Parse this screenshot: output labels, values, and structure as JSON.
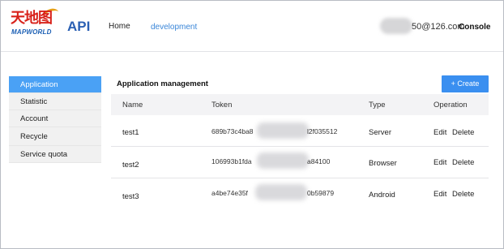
{
  "header": {
    "logo_cn": "天地图",
    "logo_en": "MAPWORLD",
    "title": "API",
    "nav": [
      "Home",
      "development"
    ],
    "email": "50@126.com",
    "console": "Console"
  },
  "sidebar": {
    "items": [
      {
        "label": "Application",
        "active": true
      },
      {
        "label": "Statistic",
        "active": false
      },
      {
        "label": "Account",
        "active": false
      },
      {
        "label": "Recycle",
        "active": false
      },
      {
        "label": "Service quota",
        "active": false
      }
    ]
  },
  "main": {
    "title": "Application management",
    "create_label": "+ Create",
    "columns": [
      "Name",
      "Token",
      "Type",
      "Operation"
    ],
    "rows": [
      {
        "name": "test1",
        "token_start": "689b73c4ba8",
        "token_end": "l2f035512",
        "type": "Server",
        "edit": "Edit",
        "delete": "Delete"
      },
      {
        "name": "test2",
        "token_start": "106993b1fda",
        "token_end": "a84100",
        "type": "Browser",
        "edit": "Edit",
        "delete": "Delete"
      },
      {
        "name": "test3",
        "token_start": "a4be74e35f",
        "token_end": "0b59879",
        "type": "Android",
        "edit": "Edit",
        "delete": "Delete"
      }
    ]
  },
  "colors": {
    "accent": "#3a8ff0",
    "sidebar_active": "#4aa1f5",
    "logo_red": "#d8221b",
    "logo_blue": "#1b5fb4"
  }
}
